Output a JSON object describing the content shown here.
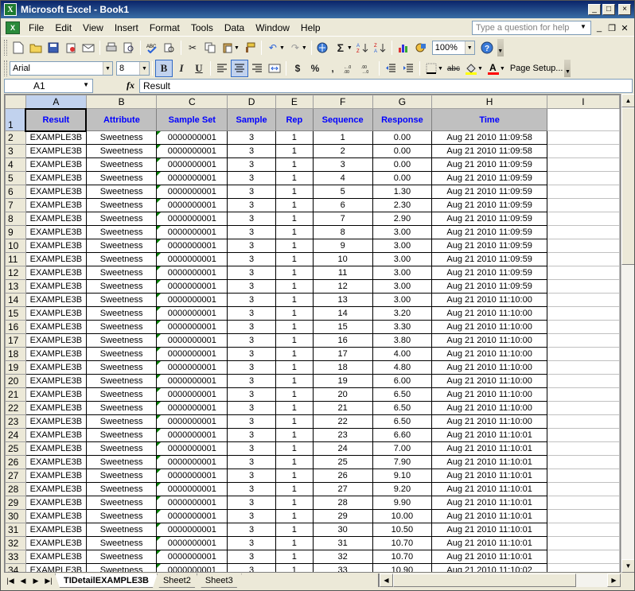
{
  "window": {
    "title": "Microsoft Excel - Book1",
    "min": "_",
    "max": "□",
    "close": "×"
  },
  "menu": {
    "items": [
      "File",
      "Edit",
      "View",
      "Insert",
      "Format",
      "Tools",
      "Data",
      "Window",
      "Help"
    ],
    "help_placeholder": "Type a question for help"
  },
  "toolbar": {
    "zoom": "100%",
    "font": "Arial",
    "font_size": "8",
    "bold": "B",
    "italic": "I",
    "underline": "U",
    "currency": "$",
    "percent": "%",
    "comma": ",",
    "page_setup": "Page Setup...",
    "sigma": "Σ"
  },
  "formula_bar": {
    "name_box": "A1",
    "fx": "fx",
    "value": "Result"
  },
  "columns": [
    "A",
    "B",
    "C",
    "D",
    "E",
    "F",
    "G",
    "H",
    "I"
  ],
  "header_row": [
    "Result",
    "Attribute",
    "Sample Set",
    "Sample",
    "Rep",
    "Sequence",
    "Response",
    "Time"
  ],
  "rows": [
    {
      "n": "2",
      "result": "EXAMPLE3B",
      "attr": "Sweetness",
      "set": "0000000001",
      "sample": "3",
      "rep": "1",
      "seq": "1",
      "resp": "0.00",
      "time": "Aug 21 2010 11:09:58"
    },
    {
      "n": "3",
      "result": "EXAMPLE3B",
      "attr": "Sweetness",
      "set": "0000000001",
      "sample": "3",
      "rep": "1",
      "seq": "2",
      "resp": "0.00",
      "time": "Aug 21 2010 11:09:58"
    },
    {
      "n": "4",
      "result": "EXAMPLE3B",
      "attr": "Sweetness",
      "set": "0000000001",
      "sample": "3",
      "rep": "1",
      "seq": "3",
      "resp": "0.00",
      "time": "Aug 21 2010 11:09:59"
    },
    {
      "n": "5",
      "result": "EXAMPLE3B",
      "attr": "Sweetness",
      "set": "0000000001",
      "sample": "3",
      "rep": "1",
      "seq": "4",
      "resp": "0.00",
      "time": "Aug 21 2010 11:09:59"
    },
    {
      "n": "6",
      "result": "EXAMPLE3B",
      "attr": "Sweetness",
      "set": "0000000001",
      "sample": "3",
      "rep": "1",
      "seq": "5",
      "resp": "1.30",
      "time": "Aug 21 2010 11:09:59"
    },
    {
      "n": "7",
      "result": "EXAMPLE3B",
      "attr": "Sweetness",
      "set": "0000000001",
      "sample": "3",
      "rep": "1",
      "seq": "6",
      "resp": "2.30",
      "time": "Aug 21 2010 11:09:59"
    },
    {
      "n": "8",
      "result": "EXAMPLE3B",
      "attr": "Sweetness",
      "set": "0000000001",
      "sample": "3",
      "rep": "1",
      "seq": "7",
      "resp": "2.90",
      "time": "Aug 21 2010 11:09:59"
    },
    {
      "n": "9",
      "result": "EXAMPLE3B",
      "attr": "Sweetness",
      "set": "0000000001",
      "sample": "3",
      "rep": "1",
      "seq": "8",
      "resp": "3.00",
      "time": "Aug 21 2010 11:09:59"
    },
    {
      "n": "10",
      "result": "EXAMPLE3B",
      "attr": "Sweetness",
      "set": "0000000001",
      "sample": "3",
      "rep": "1",
      "seq": "9",
      "resp": "3.00",
      "time": "Aug 21 2010 11:09:59"
    },
    {
      "n": "11",
      "result": "EXAMPLE3B",
      "attr": "Sweetness",
      "set": "0000000001",
      "sample": "3",
      "rep": "1",
      "seq": "10",
      "resp": "3.00",
      "time": "Aug 21 2010 11:09:59"
    },
    {
      "n": "12",
      "result": "EXAMPLE3B",
      "attr": "Sweetness",
      "set": "0000000001",
      "sample": "3",
      "rep": "1",
      "seq": "11",
      "resp": "3.00",
      "time": "Aug 21 2010 11:09:59"
    },
    {
      "n": "13",
      "result": "EXAMPLE3B",
      "attr": "Sweetness",
      "set": "0000000001",
      "sample": "3",
      "rep": "1",
      "seq": "12",
      "resp": "3.00",
      "time": "Aug 21 2010 11:09:59"
    },
    {
      "n": "14",
      "result": "EXAMPLE3B",
      "attr": "Sweetness",
      "set": "0000000001",
      "sample": "3",
      "rep": "1",
      "seq": "13",
      "resp": "3.00",
      "time": "Aug 21 2010 11:10:00"
    },
    {
      "n": "15",
      "result": "EXAMPLE3B",
      "attr": "Sweetness",
      "set": "0000000001",
      "sample": "3",
      "rep": "1",
      "seq": "14",
      "resp": "3.20",
      "time": "Aug 21 2010 11:10:00"
    },
    {
      "n": "16",
      "result": "EXAMPLE3B",
      "attr": "Sweetness",
      "set": "0000000001",
      "sample": "3",
      "rep": "1",
      "seq": "15",
      "resp": "3.30",
      "time": "Aug 21 2010 11:10:00"
    },
    {
      "n": "17",
      "result": "EXAMPLE3B",
      "attr": "Sweetness",
      "set": "0000000001",
      "sample": "3",
      "rep": "1",
      "seq": "16",
      "resp": "3.80",
      "time": "Aug 21 2010 11:10:00"
    },
    {
      "n": "18",
      "result": "EXAMPLE3B",
      "attr": "Sweetness",
      "set": "0000000001",
      "sample": "3",
      "rep": "1",
      "seq": "17",
      "resp": "4.00",
      "time": "Aug 21 2010 11:10:00"
    },
    {
      "n": "19",
      "result": "EXAMPLE3B",
      "attr": "Sweetness",
      "set": "0000000001",
      "sample": "3",
      "rep": "1",
      "seq": "18",
      "resp": "4.80",
      "time": "Aug 21 2010 11:10:00"
    },
    {
      "n": "20",
      "result": "EXAMPLE3B",
      "attr": "Sweetness",
      "set": "0000000001",
      "sample": "3",
      "rep": "1",
      "seq": "19",
      "resp": "6.00",
      "time": "Aug 21 2010 11:10:00"
    },
    {
      "n": "21",
      "result": "EXAMPLE3B",
      "attr": "Sweetness",
      "set": "0000000001",
      "sample": "3",
      "rep": "1",
      "seq": "20",
      "resp": "6.50",
      "time": "Aug 21 2010 11:10:00"
    },
    {
      "n": "22",
      "result": "EXAMPLE3B",
      "attr": "Sweetness",
      "set": "0000000001",
      "sample": "3",
      "rep": "1",
      "seq": "21",
      "resp": "6.50",
      "time": "Aug 21 2010 11:10:00"
    },
    {
      "n": "23",
      "result": "EXAMPLE3B",
      "attr": "Sweetness",
      "set": "0000000001",
      "sample": "3",
      "rep": "1",
      "seq": "22",
      "resp": "6.50",
      "time": "Aug 21 2010 11:10:00"
    },
    {
      "n": "24",
      "result": "EXAMPLE3B",
      "attr": "Sweetness",
      "set": "0000000001",
      "sample": "3",
      "rep": "1",
      "seq": "23",
      "resp": "6.60",
      "time": "Aug 21 2010 11:10:01"
    },
    {
      "n": "25",
      "result": "EXAMPLE3B",
      "attr": "Sweetness",
      "set": "0000000001",
      "sample": "3",
      "rep": "1",
      "seq": "24",
      "resp": "7.00",
      "time": "Aug 21 2010 11:10:01"
    },
    {
      "n": "26",
      "result": "EXAMPLE3B",
      "attr": "Sweetness",
      "set": "0000000001",
      "sample": "3",
      "rep": "1",
      "seq": "25",
      "resp": "7.90",
      "time": "Aug 21 2010 11:10:01"
    },
    {
      "n": "27",
      "result": "EXAMPLE3B",
      "attr": "Sweetness",
      "set": "0000000001",
      "sample": "3",
      "rep": "1",
      "seq": "26",
      "resp": "9.10",
      "time": "Aug 21 2010 11:10:01"
    },
    {
      "n": "28",
      "result": "EXAMPLE3B",
      "attr": "Sweetness",
      "set": "0000000001",
      "sample": "3",
      "rep": "1",
      "seq": "27",
      "resp": "9.20",
      "time": "Aug 21 2010 11:10:01"
    },
    {
      "n": "29",
      "result": "EXAMPLE3B",
      "attr": "Sweetness",
      "set": "0000000001",
      "sample": "3",
      "rep": "1",
      "seq": "28",
      "resp": "9.90",
      "time": "Aug 21 2010 11:10:01"
    },
    {
      "n": "30",
      "result": "EXAMPLE3B",
      "attr": "Sweetness",
      "set": "0000000001",
      "sample": "3",
      "rep": "1",
      "seq": "29",
      "resp": "10.00",
      "time": "Aug 21 2010 11:10:01"
    },
    {
      "n": "31",
      "result": "EXAMPLE3B",
      "attr": "Sweetness",
      "set": "0000000001",
      "sample": "3",
      "rep": "1",
      "seq": "30",
      "resp": "10.50",
      "time": "Aug 21 2010 11:10:01"
    },
    {
      "n": "32",
      "result": "EXAMPLE3B",
      "attr": "Sweetness",
      "set": "0000000001",
      "sample": "3",
      "rep": "1",
      "seq": "31",
      "resp": "10.70",
      "time": "Aug 21 2010 11:10:01"
    },
    {
      "n": "33",
      "result": "EXAMPLE3B",
      "attr": "Sweetness",
      "set": "0000000001",
      "sample": "3",
      "rep": "1",
      "seq": "32",
      "resp": "10.70",
      "time": "Aug 21 2010 11:10:01"
    },
    {
      "n": "34",
      "result": "EXAMPLE3B",
      "attr": "Sweetness",
      "set": "0000000001",
      "sample": "3",
      "rep": "1",
      "seq": "33",
      "resp": "10.90",
      "time": "Aug 21 2010 11:10:02"
    }
  ],
  "sheet_tabs": [
    "TIDetailEXAMPLE3B",
    "Sheet2",
    "Sheet3"
  ],
  "active_tab": "TIDetailEXAMPLE3B",
  "colors": {
    "title_bar": "#0a246a",
    "header_text": "#0000ff",
    "header_fill": "#c0c0c0"
  }
}
